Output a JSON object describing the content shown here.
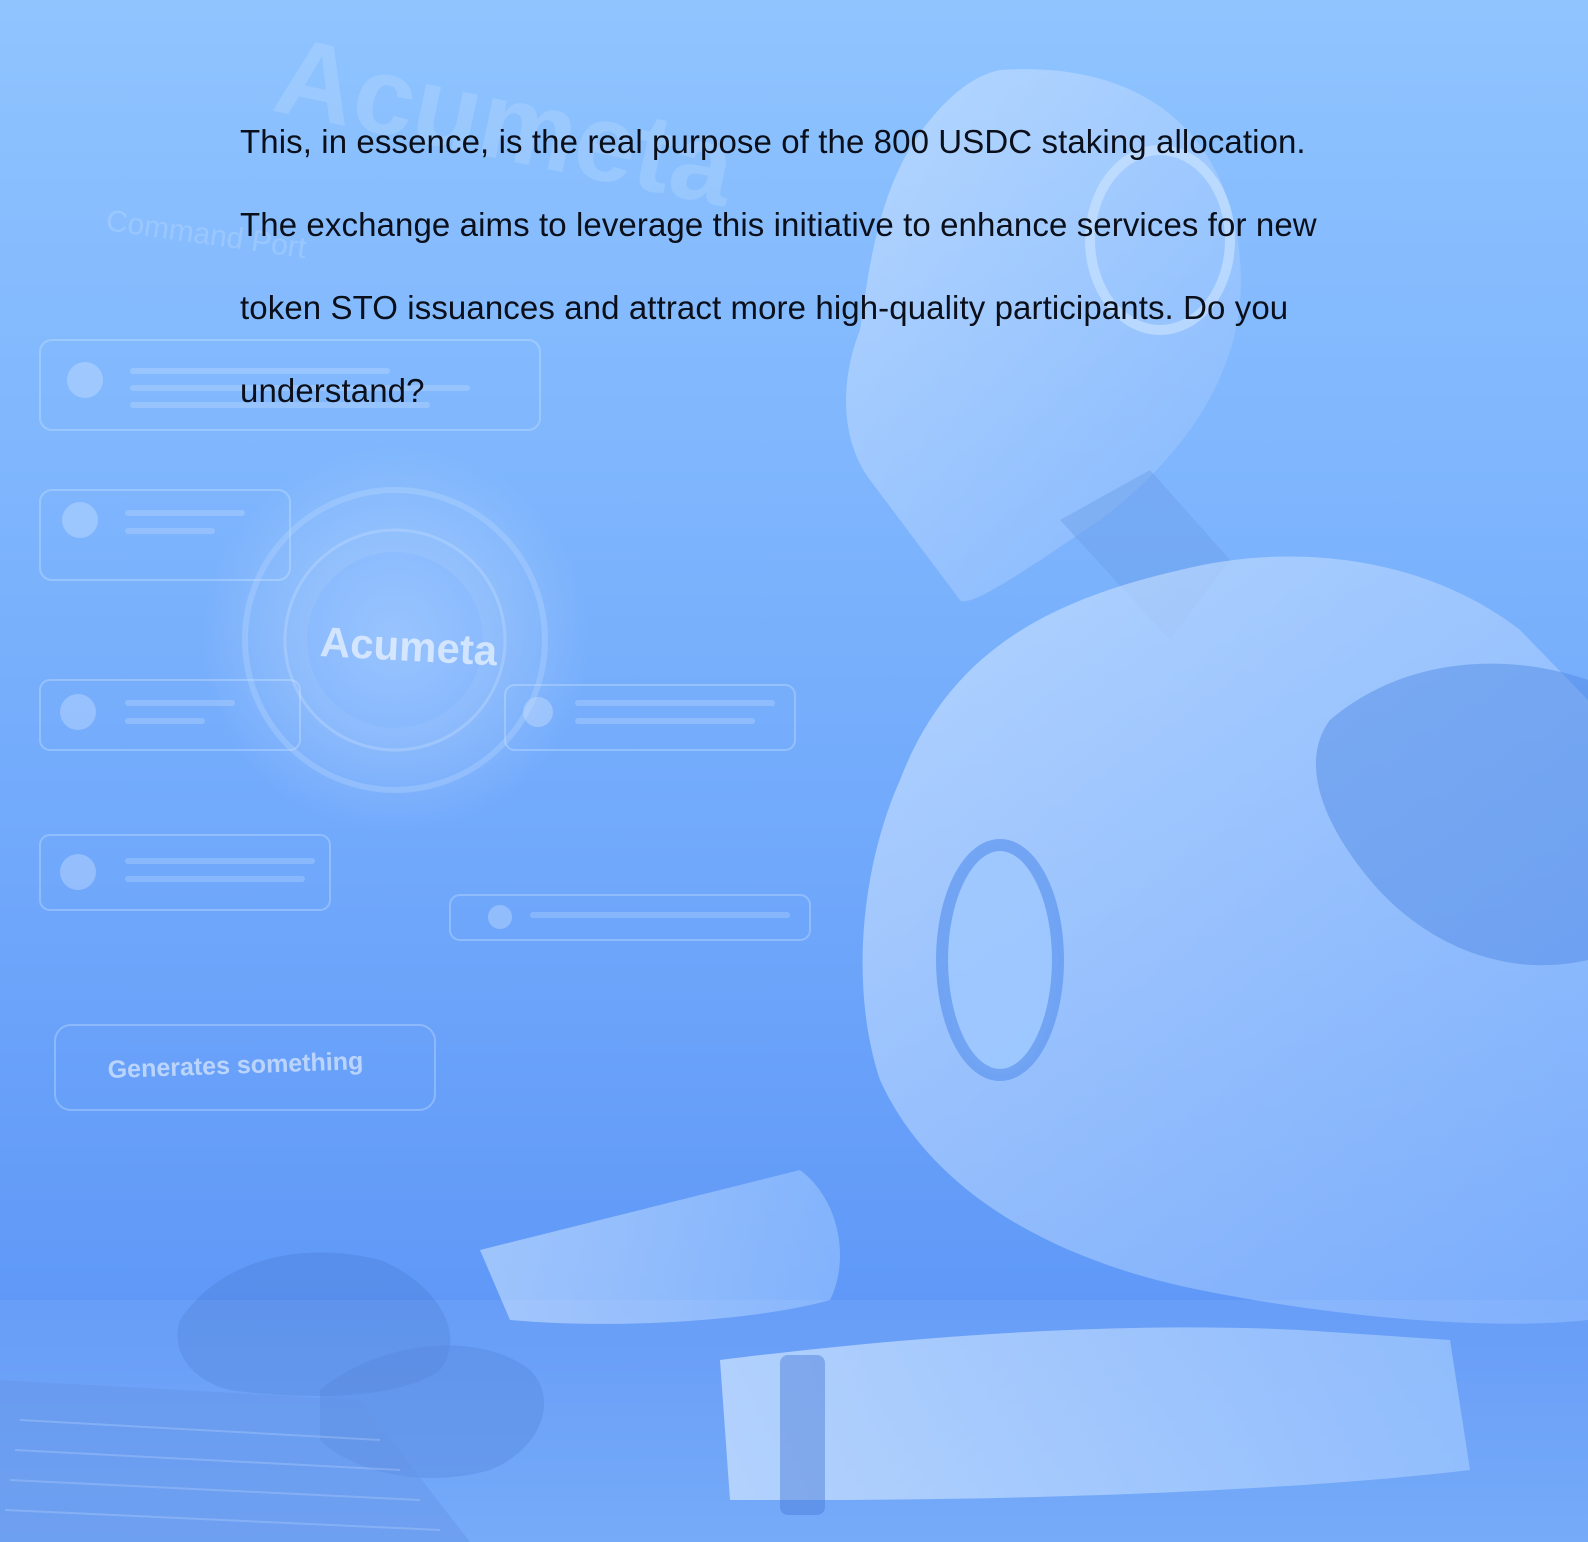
{
  "document": {
    "paragraph": "This, in essence, is the real purpose of the 800 USDC staking allocation. The exchange aims to leverage this initiative to enhance services for new token STO issuances and attract more high-quality participants. Do you understand?"
  },
  "background": {
    "logo_text": "Acumeta",
    "watermark_text": "Acumeta",
    "panel_heading": "Command Port",
    "input_text": "Generates something",
    "colors": {
      "sky_top": "#8fc4ff",
      "sky_bottom": "#5f98f7",
      "robot_body": "#b9d8ff",
      "robot_shadow": "#4d86e6",
      "panel_glow": "#a9d2ff"
    }
  }
}
